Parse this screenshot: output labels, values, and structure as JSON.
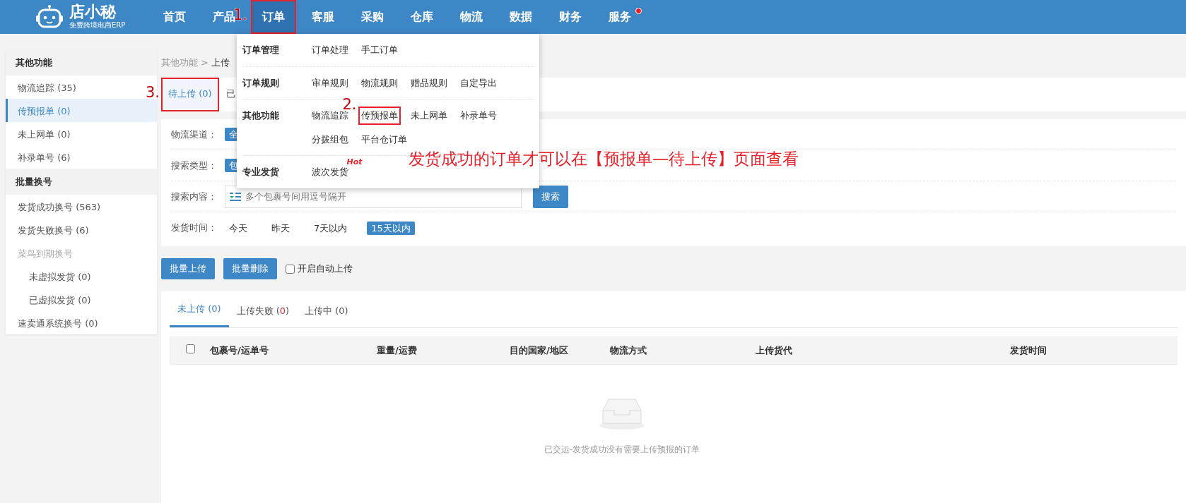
{
  "logo": {
    "name": "店小秘",
    "tagline": "免费跨境电商ERP"
  },
  "nav": [
    {
      "label": "首页",
      "selected": false,
      "highlighted": false,
      "dot": false
    },
    {
      "label": "产品",
      "selected": false,
      "highlighted": false,
      "dot": false
    },
    {
      "label": "订单",
      "selected": true,
      "highlighted": true,
      "annotation": "1.",
      "dot": false
    },
    {
      "label": "客服",
      "selected": false,
      "highlighted": false,
      "dot": false
    },
    {
      "label": "采购",
      "selected": false,
      "highlighted": false,
      "dot": false
    },
    {
      "label": "仓库",
      "selected": false,
      "highlighted": false,
      "dot": false
    },
    {
      "label": "物流",
      "selected": false,
      "highlighted": false,
      "dot": false
    },
    {
      "label": "数据",
      "selected": false,
      "highlighted": false,
      "dot": false
    },
    {
      "label": "财务",
      "selected": false,
      "highlighted": false,
      "dot": false
    },
    {
      "label": "服务",
      "selected": false,
      "highlighted": false,
      "dot": true
    }
  ],
  "dropdown": [
    {
      "title": "订单管理",
      "items": [
        {
          "label": "订单处理",
          "highlighted": false
        },
        {
          "label": "手工订单",
          "highlighted": false
        }
      ]
    },
    {
      "title": "订单规则",
      "items": [
        {
          "label": "审单规则",
          "highlighted": false
        },
        {
          "label": "物流规则",
          "highlighted": false
        },
        {
          "label": "赠品规则",
          "highlighted": false
        },
        {
          "label": "自定导出",
          "highlighted": false
        }
      ]
    },
    {
      "title": "其他功能",
      "items": [
        {
          "label": "物流追踪",
          "highlighted": false
        },
        {
          "label": "传预报单",
          "highlighted": true,
          "annotation": "2."
        },
        {
          "label": "未上网单",
          "highlighted": false
        },
        {
          "label": "补录单号",
          "highlighted": false
        },
        {
          "label": "分拨组包",
          "highlighted": false
        },
        {
          "label": "平台仓订单",
          "highlighted": false
        }
      ]
    },
    {
      "title": "专业发货",
      "items": [
        {
          "label": "波次发货",
          "highlighted": false,
          "badge": "Hot"
        }
      ]
    }
  ],
  "note": "发货成功的订单才可以在【预报单—待上传】页面查看",
  "sidebar": [
    {
      "title": "其他功能",
      "items": [
        {
          "label": "物流追踪 (35)",
          "selected": false,
          "disabled": false
        },
        {
          "label": "传预报单 (0)",
          "selected": true,
          "disabled": false
        },
        {
          "label": "未上网单 (0)",
          "selected": false,
          "disabled": false
        },
        {
          "label": "补录单号 (6)",
          "selected": false,
          "disabled": false
        }
      ]
    },
    {
      "title": "批量换号",
      "items": [
        {
          "label": "发货成功换号 (563)",
          "selected": false,
          "disabled": false
        },
        {
          "label": "发货失败换号 (6)",
          "selected": false,
          "disabled": false
        },
        {
          "label": "菜鸟到期换号",
          "selected": false,
          "disabled": true,
          "children": [
            {
              "label": "未虚拟发货 (0)",
              "selected": false,
              "disabled": false
            },
            {
              "label": "已虚拟发货 (0)",
              "selected": false,
              "disabled": false
            }
          ]
        },
        {
          "label": "速卖通系统换号 (0)",
          "selected": false,
          "disabled": false
        }
      ]
    }
  ],
  "breadcrumb": {
    "items": [
      "其他功能",
      "上传"
    ],
    "separator": ">"
  },
  "status_tabs": [
    {
      "label": "待上传 (0)",
      "selected": true,
      "highlighted": true,
      "annotation": "3."
    },
    {
      "label": "已",
      "selected": false,
      "highlighted": false
    }
  ],
  "filters": [
    {
      "label": "物流渠道：",
      "kind": "tags",
      "options": [
        {
          "label": "全",
          "selected": true
        }
      ]
    },
    {
      "label": "搜索类型：",
      "kind": "tags",
      "options": [
        {
          "label": "包",
          "selected": true
        }
      ]
    },
    {
      "label": "搜索内容：",
      "kind": "search",
      "placeholder": "多个包裹号间用逗号隔开",
      "button": "搜索"
    },
    {
      "label": "发货时间：",
      "kind": "tags",
      "options": [
        {
          "label": "今天",
          "selected": false
        },
        {
          "label": "昨天",
          "selected": false
        },
        {
          "label": "7天以内",
          "selected": false
        },
        {
          "label": "15天以内",
          "selected": true
        }
      ]
    }
  ],
  "actions": [
    {
      "label": "批量上传"
    },
    {
      "label": "批量删除"
    }
  ],
  "auto_upload": {
    "label": "开启自动上传",
    "checked": false
  },
  "upload_tabs": [
    {
      "selected": true,
      "parts": [
        {
          "text": "未上传 (0)",
          "alert": false
        }
      ]
    },
    {
      "selected": false,
      "parts": [
        {
          "text": "上传失败 (",
          "alert": false
        },
        {
          "text": "0",
          "alert": true
        },
        {
          "text": ")",
          "alert": false
        }
      ]
    },
    {
      "selected": false,
      "parts": [
        {
          "text": "上传中 (0)",
          "alert": false
        }
      ]
    }
  ],
  "table": {
    "select_all": false,
    "columns": [
      "包裹号/运单号",
      "重量/运费",
      "目的国家/地区",
      "物流方式",
      "上传货代",
      "发货时间"
    ],
    "empty_text": "已交运-发货成功没有需要上传预报的订单"
  }
}
